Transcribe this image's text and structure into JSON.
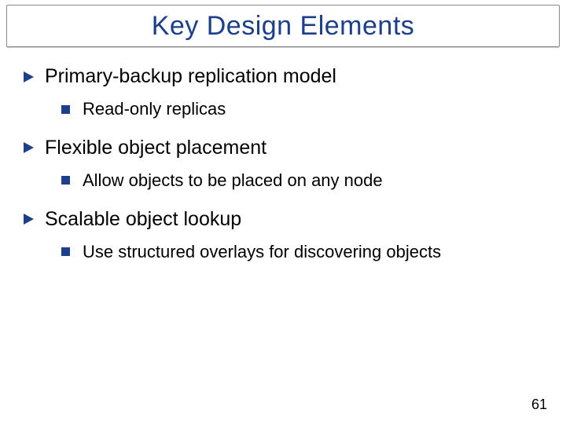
{
  "title": "Key Design Elements",
  "points": [
    {
      "heading": "Primary-backup replication model",
      "sub": "Read-only replicas"
    },
    {
      "heading": "Flexible object placement",
      "sub": "Allow objects to be placed on any node"
    },
    {
      "heading": "Scalable object lookup",
      "sub": "Use structured overlays for discovering objects"
    }
  ],
  "page_number": "61"
}
